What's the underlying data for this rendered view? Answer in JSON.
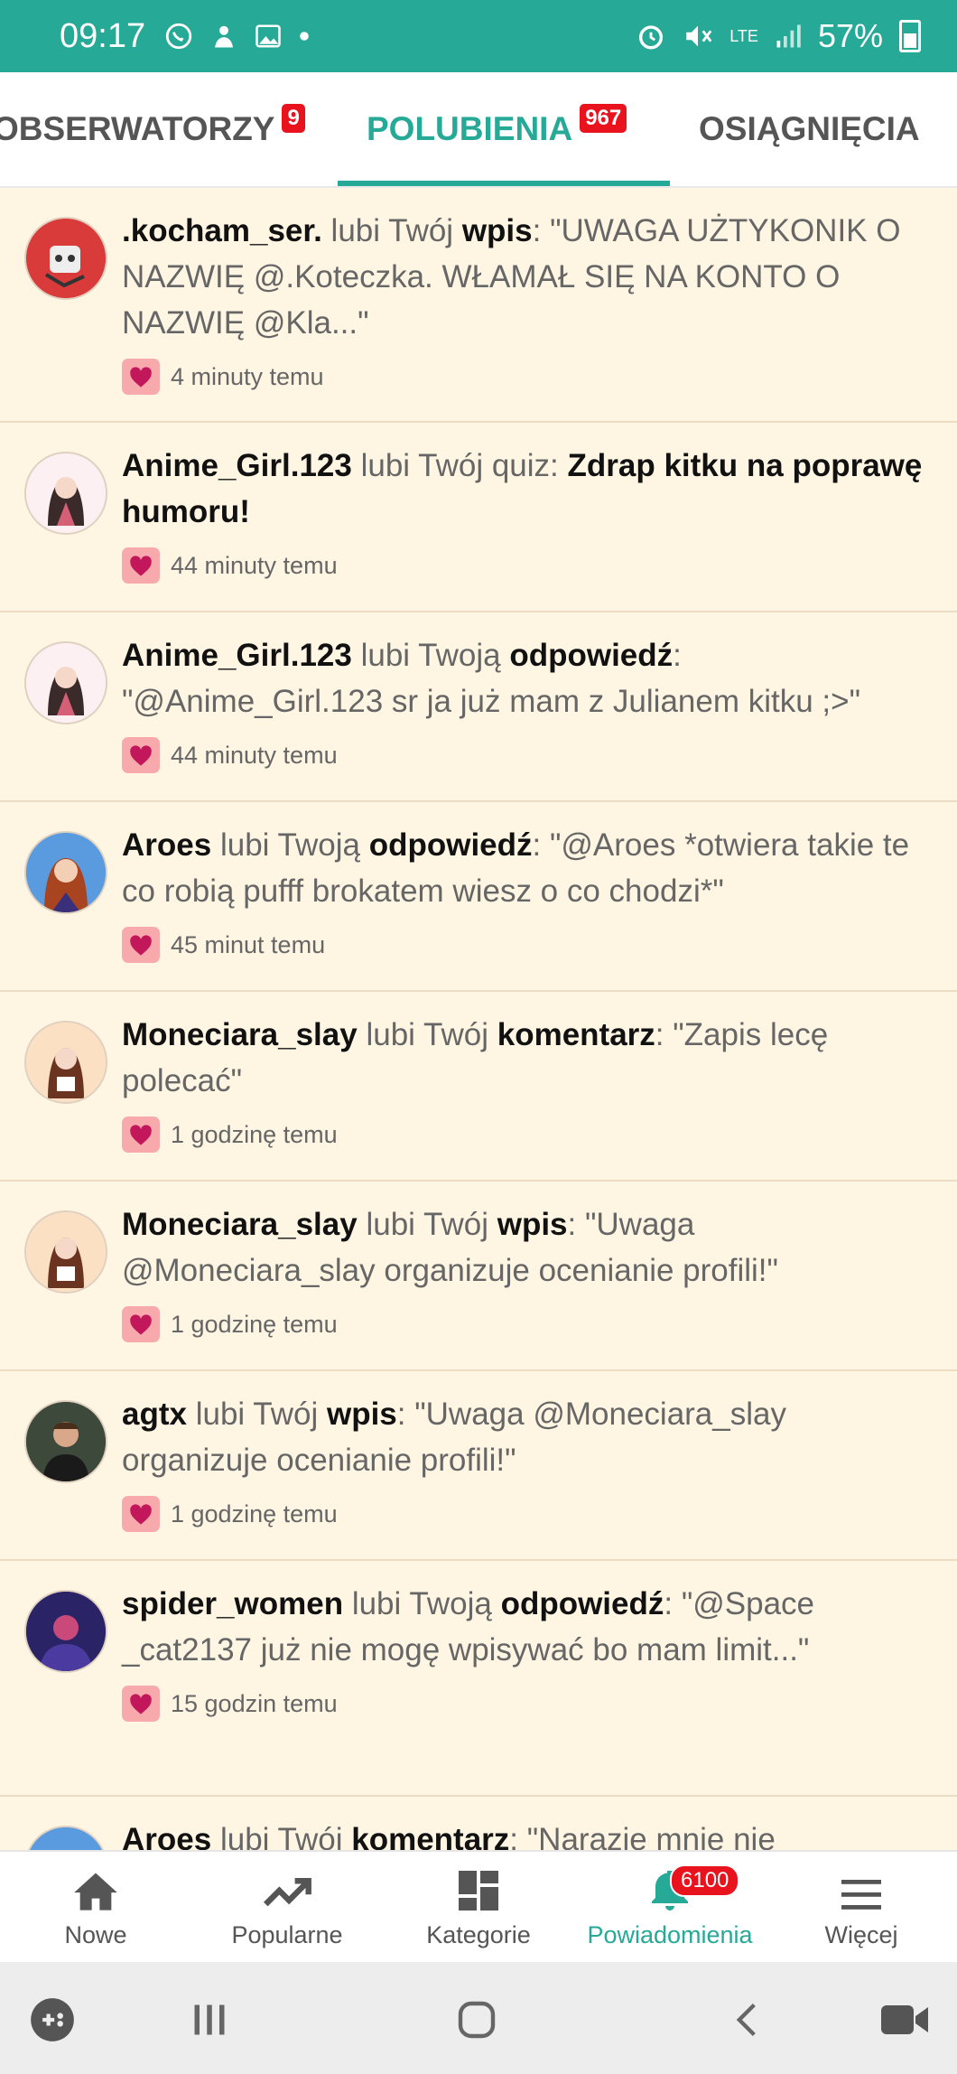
{
  "status": {
    "time": "09:17",
    "network": "LTE",
    "battery": "57%"
  },
  "tabs": [
    {
      "label": "OBSERWATORZY",
      "badge": "9"
    },
    {
      "label": "POLUBIENIA",
      "badge": "967"
    },
    {
      "label": "OSIĄGNIĘCIA"
    }
  ],
  "notifications": [
    {
      "user": ".kocham_ser.",
      "verb": "lubi Twój",
      "object": "wpis",
      "sep": ": ",
      "quote": "\"UWAGA UŻTYKONIK O NAZWIĘ @.Koteczka. WŁAMAŁ SIĘ NA KONTO O NAZWIĘ @Kla...\"",
      "time": "4 minuty temu"
    },
    {
      "user": "Anime_Girl.123",
      "verb": "lubi Twój quiz:",
      "object": "Zdrap kitku na poprawę humoru!",
      "sep": "",
      "quote": "",
      "time": "44 minuty temu"
    },
    {
      "user": "Anime_Girl.123",
      "verb": "lubi Twoją",
      "object": "odpowiedź",
      "sep": ": ",
      "quote": "\"@Anime_Girl.123 sr ja już mam z Julianem kitku ;>\"",
      "time": "44 minuty temu"
    },
    {
      "user": "Aroes",
      "verb": "lubi Twoją",
      "object": "odpowiedź",
      "sep": ": ",
      "quote": "\"@Aroes *otwiera takie te co robią pufff brokatem wiesz o co chodzi*\"",
      "time": "45 minut temu"
    },
    {
      "user": "Moneciara_slay",
      "verb": "lubi Twój",
      "object": "komentarz",
      "sep": ": ",
      "quote": "\"Zapis lecę polecać\"",
      "time": "1 godzinę temu"
    },
    {
      "user": "Moneciara_slay",
      "verb": "lubi Twój",
      "object": "wpis",
      "sep": ": ",
      "quote": "\"Uwaga @Moneciara_slay organizuje ocenianie profili!\"",
      "time": "1 godzinę temu"
    },
    {
      "user": "agtx",
      "verb": "lubi Twój",
      "object": "wpis",
      "sep": ": ",
      "quote": "\"Uwaga @Moneciara_slay organizuje ocenianie profili!\"",
      "time": "1 godzinę temu"
    },
    {
      "user": "spider_women",
      "verb": "lubi Twoją",
      "object": "odpowiedź",
      "sep": ": ",
      "quote": "\"@Space _cat2137 już nie mogę wpisywać bo mam limit...\"",
      "time": "15 godzin temu"
    },
    {
      "user": "Aroes",
      "verb": "lubi Twój",
      "object": "komentarz",
      "sep": ": ",
      "quote": "\"Narazie mnie nie",
      "time": ""
    }
  ],
  "bottom_nav": [
    {
      "label": "Nowe",
      "icon": "home-icon"
    },
    {
      "label": "Popularne",
      "icon": "trending-icon"
    },
    {
      "label": "Kategorie",
      "icon": "grid-icon"
    },
    {
      "label": "Powiadomienia",
      "icon": "bell-icon",
      "badge": "6100"
    },
    {
      "label": "Więcej",
      "icon": "menu-icon"
    }
  ],
  "colors": {
    "accent": "#26a996",
    "badge": "#e8131d",
    "background": "#fff5e3",
    "heart": "#c2185b"
  }
}
